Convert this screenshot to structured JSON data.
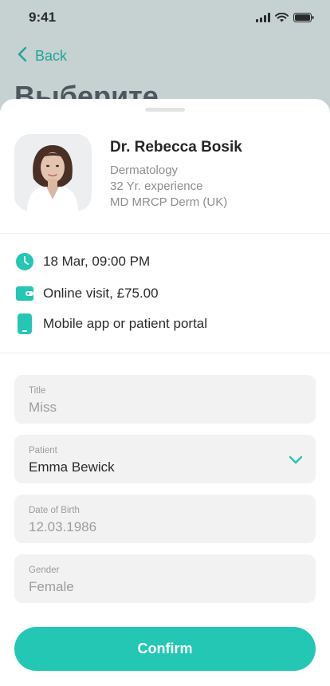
{
  "status": {
    "time": "9:41"
  },
  "nav": {
    "back_label": "Back"
  },
  "background": {
    "title": "Выберите"
  },
  "doctor": {
    "name": "Dr. Rebecca Bosik",
    "specialty": "Dermatology",
    "experience": "32 Yr. experience",
    "credentials": "MD MRCP Derm (UK)"
  },
  "appointment": {
    "datetime": "18 Mar, 09:00 PM",
    "visit": "Online visit, £75.00",
    "channel": "Mobile app or patient portal"
  },
  "form": {
    "title": {
      "label": "Title",
      "value": "Miss"
    },
    "patient": {
      "label": "Patient",
      "value": "Emma Bewick"
    },
    "dob": {
      "label": "Date of Birth",
      "value": "12.03.1986"
    },
    "gender": {
      "label": "Gender",
      "value": "Female"
    }
  },
  "actions": {
    "confirm_label": "Confirm"
  },
  "colors": {
    "accent": "#24c6b4",
    "accent_dark": "#1fa59a"
  }
}
